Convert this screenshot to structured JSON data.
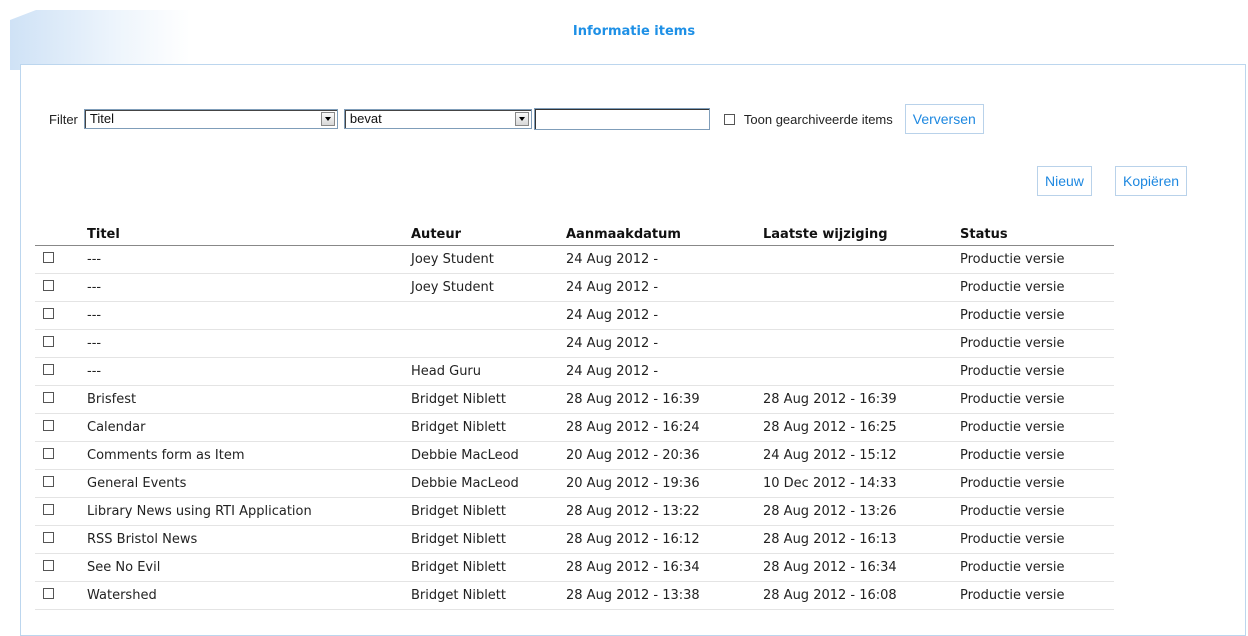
{
  "page": {
    "title": "Informatie items"
  },
  "filter": {
    "label": "Filter",
    "field_value": "Titel",
    "operator_value": "bevat",
    "text_value": "",
    "show_archived_label": "Toon gearchiveerde items",
    "refresh_label": "Verversen"
  },
  "actions": {
    "new_label": "Nieuw",
    "copy_label": "Kopiëren"
  },
  "table": {
    "headers": {
      "title": "Titel",
      "author": "Auteur",
      "created": "Aanmaakdatum",
      "modified": "Laatste wijziging",
      "status": "Status"
    },
    "rows": [
      {
        "title": "---",
        "author": "Joey Student",
        "created": "24 Aug 2012 -",
        "modified": "",
        "status": "Productie versie"
      },
      {
        "title": "---",
        "author": "Joey Student",
        "created": "24 Aug 2012 -",
        "modified": "",
        "status": "Productie versie"
      },
      {
        "title": "---",
        "author": "",
        "created": "24 Aug 2012 -",
        "modified": "",
        "status": "Productie versie"
      },
      {
        "title": "---",
        "author": "",
        "created": "24 Aug 2012 -",
        "modified": "",
        "status": "Productie versie"
      },
      {
        "title": "---",
        "author": "Head Guru",
        "created": "24 Aug 2012 -",
        "modified": "",
        "status": "Productie versie"
      },
      {
        "title": "Brisfest",
        "author": "Bridget Niblett",
        "created": "28 Aug 2012 - 16:39",
        "modified": "28 Aug 2012 - 16:39",
        "status": "Productie versie"
      },
      {
        "title": "Calendar",
        "author": "Bridget Niblett",
        "created": "28 Aug 2012 - 16:24",
        "modified": "28 Aug 2012 - 16:25",
        "status": "Productie versie"
      },
      {
        "title": "Comments form as Item",
        "author": "Debbie MacLeod",
        "created": "20 Aug 2012 - 20:36",
        "modified": "24 Aug 2012 - 15:12",
        "status": "Productie versie"
      },
      {
        "title": "General Events",
        "author": "Debbie MacLeod",
        "created": "20 Aug 2012 - 19:36",
        "modified": "10 Dec 2012 - 14:33",
        "status": "Productie versie"
      },
      {
        "title": "Library News using RTI Application",
        "author": "Bridget Niblett",
        "created": "28 Aug 2012 - 13:22",
        "modified": "28 Aug 2012 - 13:26",
        "status": "Productie versie"
      },
      {
        "title": "RSS Bristol News",
        "author": "Bridget Niblett",
        "created": "28 Aug 2012 - 16:12",
        "modified": "28 Aug 2012 - 16:13",
        "status": "Productie versie"
      },
      {
        "title": "See No Evil",
        "author": "Bridget Niblett",
        "created": "28 Aug 2012 - 16:34",
        "modified": "28 Aug 2012 - 16:34",
        "status": "Productie versie"
      },
      {
        "title": "Watershed",
        "author": "Bridget Niblett",
        "created": "28 Aug 2012 - 13:38",
        "modified": "28 Aug 2012 - 16:08",
        "status": "Productie versie"
      }
    ]
  },
  "colors": {
    "accent": "#1e88e0",
    "panel_border": "#bcd6ee"
  }
}
